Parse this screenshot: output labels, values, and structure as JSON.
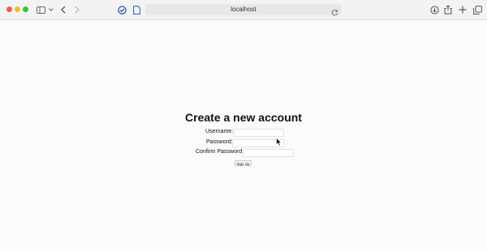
{
  "browser": {
    "url": "localhost",
    "window_controls": [
      "close",
      "minimize",
      "zoom"
    ],
    "colors": {
      "close": "#ee5e56",
      "minimize": "#f5bd2f",
      "zoom": "#2fc840"
    }
  },
  "form": {
    "title": "Create a new account",
    "username_label": "Username:",
    "password_label": "Password:",
    "confirm_password_label": "Confirm Password:",
    "username_value": "",
    "password_value": "",
    "confirm_password_value": "",
    "submit_label": "Sign Up"
  }
}
